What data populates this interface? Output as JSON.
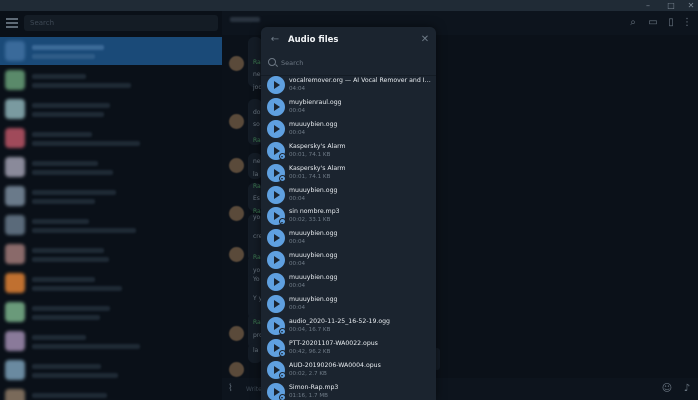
{
  "window": {
    "controls": [
      "–",
      "□",
      "✕"
    ]
  },
  "sidebar": {
    "search_placeholder": "Search"
  },
  "chat": {
    "snippets": [
      "Ra",
      "ne",
      "jod",
      "do",
      "so",
      "Ra",
      "ne",
      "la",
      "Ra",
      "Es",
      "Ra",
      "yo",
      "cre",
      "Ra",
      "yo",
      "Yo",
      "Y y",
      "Ra",
      "pro",
      "la"
    ],
    "composer_placeholder": "Write a message..."
  },
  "modal": {
    "title": "Audio files",
    "search_placeholder": "Search",
    "files": [
      {
        "name": "vocalremover.org — AI Vocal Remover and Isola...",
        "meta": "04:04",
        "downloaded": true
      },
      {
        "name": "muybienraul.ogg",
        "meta": "00:04",
        "downloaded": true
      },
      {
        "name": "muuuybien.ogg",
        "meta": "00:04",
        "downloaded": true
      },
      {
        "name": "Kaspersky's Alarm",
        "meta": "00:01, 74.1 KB",
        "downloaded": false
      },
      {
        "name": "Kaspersky's Alarm",
        "meta": "00:01, 74.1 KB",
        "downloaded": false
      },
      {
        "name": "muuuybien.ogg",
        "meta": "00:04",
        "downloaded": true
      },
      {
        "name": "sin nombre.mp3",
        "meta": "00:02, 33.1 KB",
        "downloaded": false
      },
      {
        "name": "muuuybien.ogg",
        "meta": "00:04",
        "downloaded": true
      },
      {
        "name": "muuuybien.ogg",
        "meta": "00:04",
        "downloaded": true
      },
      {
        "name": "muuuybien.ogg",
        "meta": "00:04",
        "downloaded": true
      },
      {
        "name": "muuuybien.ogg",
        "meta": "00:04",
        "downloaded": true
      },
      {
        "name": "audio_2020-11-25_16-52-19.ogg",
        "meta": "00:04, 16.7 KB",
        "downloaded": false
      },
      {
        "name": "PTT-20201107-WA0022.opus",
        "meta": "00:42, 96.2 KB",
        "downloaded": false
      },
      {
        "name": "AUD-20190206-WA0004.opus",
        "meta": "00:02, 2.7 KB",
        "downloaded": false
      },
      {
        "name": "Simon-Rap.mp3",
        "meta": "01:16, 1.7 MB",
        "downloaded": false
      }
    ]
  },
  "colors": {
    "accent": "#5fa0e0",
    "modal_bg": "#1b242f",
    "app_bg": "#0e1621"
  }
}
